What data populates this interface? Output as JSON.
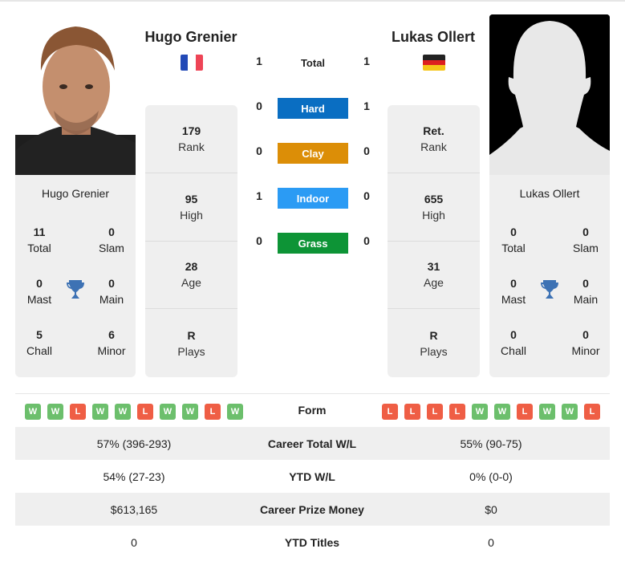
{
  "player_left": {
    "name": "Hugo Grenier",
    "country_flag": "france-flag",
    "card_name": "Hugo Grenier",
    "stats": [
      {
        "value": "179",
        "label": "Rank"
      },
      {
        "value": "95",
        "label": "High"
      },
      {
        "value": "28",
        "label": "Age"
      },
      {
        "value": "R",
        "label": "Plays"
      }
    ],
    "titles": {
      "total": {
        "value": "11",
        "label": "Total"
      },
      "slam": {
        "value": "0",
        "label": "Slam"
      },
      "mast": {
        "value": "0",
        "label": "Mast"
      },
      "main": {
        "value": "0",
        "label": "Main"
      },
      "chall": {
        "value": "5",
        "label": "Chall"
      },
      "minor": {
        "value": "6",
        "label": "Minor"
      }
    },
    "form": [
      "W",
      "W",
      "L",
      "W",
      "W",
      "L",
      "W",
      "W",
      "L",
      "W"
    ]
  },
  "player_right": {
    "name": "Lukas Ollert",
    "country_flag": "germany-flag",
    "card_name": "Lukas Ollert",
    "stats": [
      {
        "value": "Ret.",
        "label": "Rank"
      },
      {
        "value": "655",
        "label": "High"
      },
      {
        "value": "31",
        "label": "Age"
      },
      {
        "value": "R",
        "label": "Plays"
      }
    ],
    "titles": {
      "total": {
        "value": "0",
        "label": "Total"
      },
      "slam": {
        "value": "0",
        "label": "Slam"
      },
      "mast": {
        "value": "0",
        "label": "Mast"
      },
      "main": {
        "value": "0",
        "label": "Main"
      },
      "chall": {
        "value": "0",
        "label": "Chall"
      },
      "minor": {
        "value": "0",
        "label": "Minor"
      }
    },
    "form": [
      "L",
      "L",
      "L",
      "L",
      "W",
      "W",
      "L",
      "W",
      "W",
      "L"
    ]
  },
  "h2h": {
    "total": {
      "label": "Total",
      "left": "1",
      "right": "1"
    },
    "surfaces": [
      {
        "label": "Hard",
        "left": "0",
        "right": "1",
        "color": "#0a6ec2"
      },
      {
        "label": "Clay",
        "left": "0",
        "right": "0",
        "color": "#dc8e07"
      },
      {
        "label": "Indoor",
        "left": "1",
        "right": "0",
        "color": "#2b9bf4"
      },
      {
        "label": "Grass",
        "left": "0",
        "right": "0",
        "color": "#0d9436"
      }
    ]
  },
  "comparison": {
    "form_label": "Form",
    "rows": [
      {
        "left": "57% (396-293)",
        "label": "Career Total W/L",
        "right": "55% (90-75)"
      },
      {
        "left": "54% (27-23)",
        "label": "YTD W/L",
        "right": "0% (0-0)"
      },
      {
        "left": "$613,165",
        "label": "Career Prize Money",
        "right": "$0"
      },
      {
        "left": "0",
        "label": "YTD Titles",
        "right": "0"
      }
    ]
  }
}
